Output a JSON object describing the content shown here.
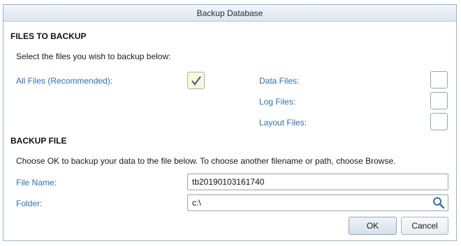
{
  "dialog": {
    "title": "Backup Database"
  },
  "files_section": {
    "heading": "FILES TO BACKUP",
    "instruction": "Select the files you wish to backup below:",
    "all_files_label": "All Files (Recommended):",
    "all_files_checked": true,
    "data_files_label": "Data Files:",
    "data_files_checked": false,
    "log_files_label": "Log Files:",
    "log_files_checked": false,
    "layout_files_label": "Layout Files:",
    "layout_files_checked": false
  },
  "backup_section": {
    "heading": "BACKUP FILE",
    "instruction": "Choose OK to backup your data to the file below.  To choose another filename or path, choose Browse.",
    "file_name_label": "File Name:",
    "file_name_value": "tb20190103161740",
    "folder_label": "Folder:",
    "folder_value": "c:\\",
    "browse_icon": "search-icon"
  },
  "buttons": {
    "ok_label": "OK",
    "cancel_label": "Cancel"
  },
  "colors": {
    "label": "#2f6fb1",
    "checked_fill": "#fbf8d7",
    "checkmark": "#2a5f9e"
  }
}
